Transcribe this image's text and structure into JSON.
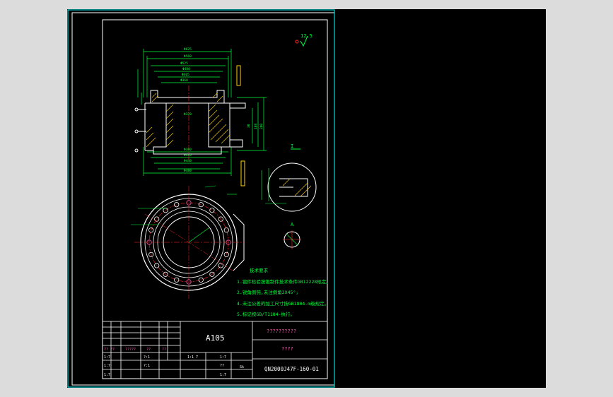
{
  "sheet": {
    "material": "A105",
    "part_name": "??????????",
    "drawing_title": "????",
    "drawing_number": "QN2000J47F-160-01",
    "scale": "1:1",
    "surface_mark": "12.5",
    "detail_a": "I",
    "detail_b": "A",
    "title_block": {
      "row_small_1": "?? ??",
      "row_small_2": "?????",
      "row_small_3": "??",
      "row_small_4": "??",
      "cell_1": "1:1 7",
      "cell_2": "1:7",
      "cell_3": "?:1",
      "cell_4": "1:7",
      "cell_5": "??",
      "cell_6": "1:7",
      "cell_7": "1:7",
      "cell_8": "?:1",
      "cell_9": "1:7",
      "cell_10": "Sk"
    }
  },
  "notes": {
    "title": "技术要求",
    "line1": "1.锻件检验按锻制件技术条件GB12228规定。",
    "line2": "2.锐角倒钝,未注倒角2X45°;",
    "line3": "4.未注公差的加工尺寸按GB1804-m级规定。",
    "line4": "5.标记按GB/T1184-执行。"
  },
  "dimensions": {
    "d_top1": "Φ625",
    "d_top2": "Φ568",
    "d_top3": "Φ525",
    "d_top4": "Φ480",
    "d_top5": "Φ405",
    "d_top6": "Φ360",
    "d_bore": "Φ370",
    "d_bot1": "Φ380",
    "d_bot2": "Φ410",
    "d_bot3": "Φ440",
    "d_bot4": "Φ480",
    "h1": "30",
    "h2": "108",
    "h3": "200"
  },
  "colors": {
    "background": "#000000",
    "outline": "#ffffff",
    "dimension": "#00ff3c",
    "hatch": "#ffd200",
    "centerline": "#ff2a2a",
    "hole": "#ff5ab4",
    "frame": "#00ffff"
  }
}
